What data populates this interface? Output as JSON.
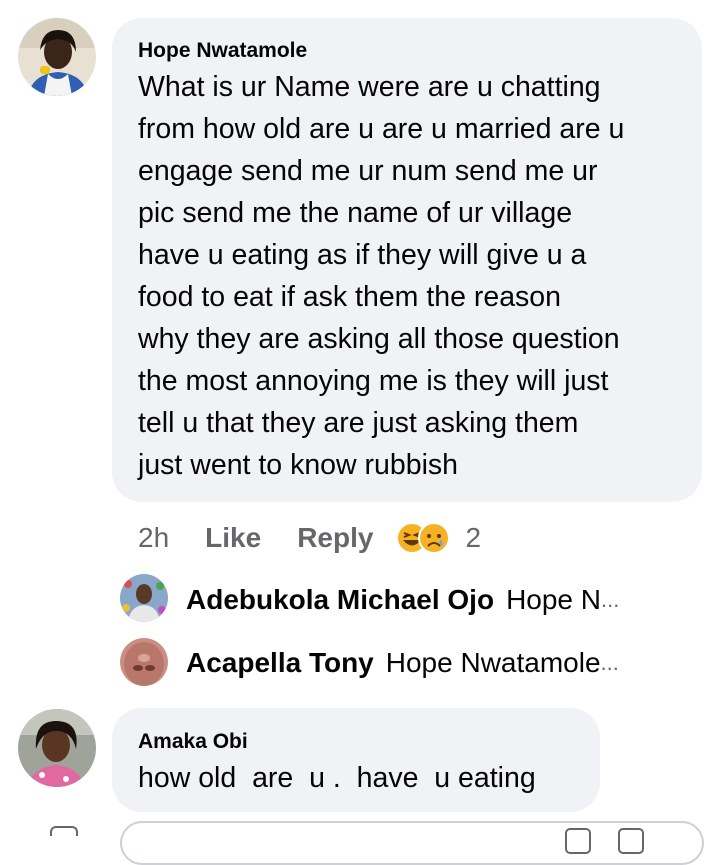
{
  "comments": [
    {
      "author": "Hope Nwatamole",
      "lines": [
        "What is ur Name were are u chatting",
        "from how old are u are u married are u",
        "engage send me ur num send me ur",
        "pic send me the name of ur village",
        "have u eating as if they will give u a",
        "food to eat  if  ask them the reason",
        "why they are asking all those question",
        "the most annoying me is they will just",
        "tell u that they are just asking them",
        "just went to know rubbish"
      ],
      "time": "2h",
      "like_label": "Like",
      "reply_label": "Reply",
      "reaction_count": "2",
      "reactions": [
        "laughing-emoji-icon",
        "sad-emoji-icon"
      ]
    },
    {
      "author": "Amaka Obi",
      "lines": [
        "how old  are  u .  have  u eating"
      ]
    }
  ],
  "replies": [
    {
      "name": "Adebukola Michael Ojo",
      "snippet": "Hope N",
      "ellipsis": "..."
    },
    {
      "name": "Acapella Tony",
      "snippet": "Hope Nwatamole",
      "ellipsis": "..."
    }
  ],
  "colors": {
    "bubble": "#f0f2f5",
    "text": "#050505",
    "secondary": "#65676b",
    "reaction_yellow": "#f7b125"
  }
}
